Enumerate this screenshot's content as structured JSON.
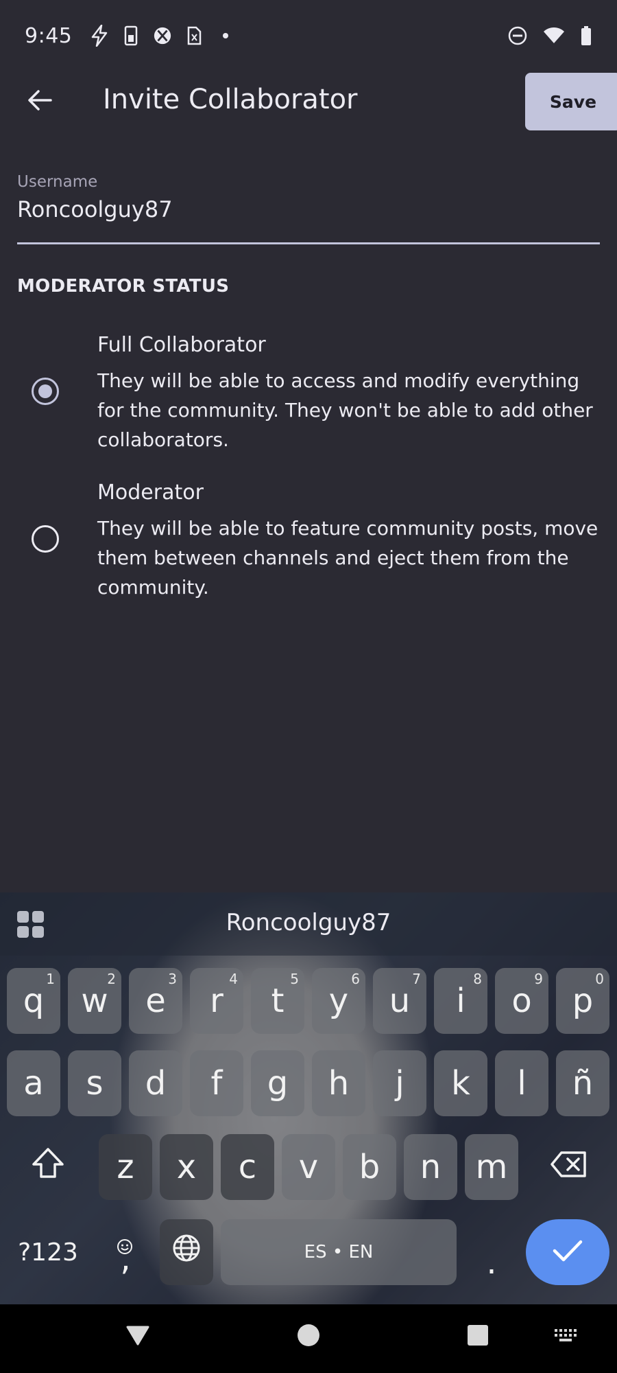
{
  "status_bar": {
    "time": "9:45",
    "left_icons": [
      "bolt-icon",
      "phone-battery-icon",
      "xbox-icon",
      "sim-icon",
      "dot-icon"
    ],
    "right_icons": [
      "do-not-disturb-icon",
      "wifi-icon",
      "battery-icon"
    ]
  },
  "app_bar": {
    "title": "Invite Collaborator",
    "save_label": "Save"
  },
  "username_field": {
    "label": "Username",
    "value": "Roncoolguy87"
  },
  "moderator_status": {
    "heading": "MODERATOR STATUS",
    "options": [
      {
        "title": "Full Collaborator",
        "description": "They will be able to access and modify everything for the community. They won't be able to add other collaborators.",
        "selected": true
      },
      {
        "title": "Moderator",
        "description": "They will be able to feature community posts, move them between channels and eject them from the community.",
        "selected": false
      }
    ]
  },
  "keyboard": {
    "suggestion": "Roncoolguy87",
    "row1": [
      {
        "key": "q",
        "hint": "1"
      },
      {
        "key": "w",
        "hint": "2"
      },
      {
        "key": "e",
        "hint": "3"
      },
      {
        "key": "r",
        "hint": "4"
      },
      {
        "key": "t",
        "hint": "5"
      },
      {
        "key": "y",
        "hint": "6"
      },
      {
        "key": "u",
        "hint": "7"
      },
      {
        "key": "i",
        "hint": "8"
      },
      {
        "key": "o",
        "hint": "9"
      },
      {
        "key": "p",
        "hint": "0"
      }
    ],
    "row2": [
      "a",
      "s",
      "d",
      "f",
      "g",
      "h",
      "j",
      "k",
      "l",
      "ñ"
    ],
    "row3": [
      "z",
      "x",
      "c",
      "v",
      "b",
      "n",
      "m"
    ],
    "symbols_label": "?123",
    "comma_label": ",",
    "space_label": "ES • EN",
    "period_label": "."
  },
  "colors": {
    "background": "#2b2a33",
    "accent": "#c2c4dc",
    "enter_key": "#5b8ff0"
  }
}
